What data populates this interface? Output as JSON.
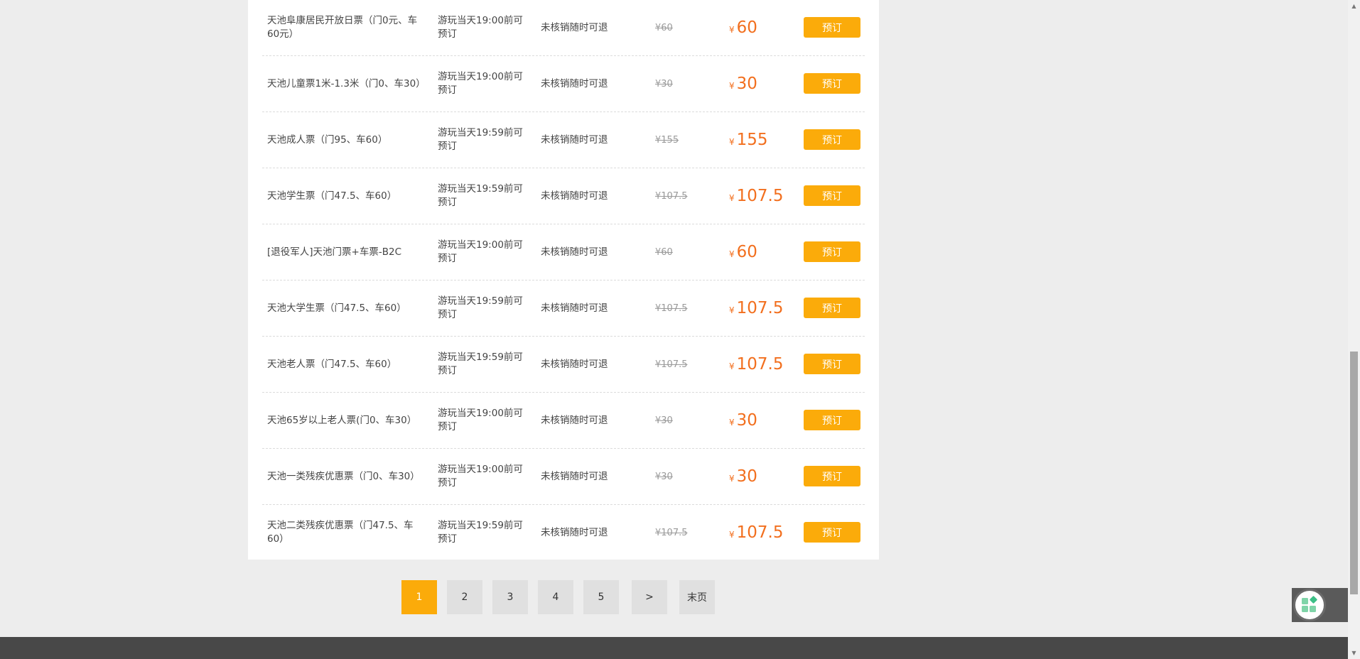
{
  "currency_symbol": "¥",
  "book_label": "预订",
  "tickets": [
    {
      "name": "天池阜康居民开放日票（门0元、车60元）",
      "booking_time": "游玩当天19:00前可预订",
      "refund": "未核销随时可退",
      "original_price": "¥60",
      "price": "60"
    },
    {
      "name": "天池儿童票1米-1.3米（门0、车30）",
      "booking_time": "游玩当天19:00前可预订",
      "refund": "未核销随时可退",
      "original_price": "¥30",
      "price": "30"
    },
    {
      "name": "天池成人票（门95、车60）",
      "booking_time": "游玩当天19:59前可预订",
      "refund": "未核销随时可退",
      "original_price": "¥155",
      "price": "155"
    },
    {
      "name": "天池学生票（门47.5、车60）",
      "booking_time": "游玩当天19:59前可预订",
      "refund": "未核销随时可退",
      "original_price": "¥107.5",
      "price": "107.5"
    },
    {
      "name": "[退役军人]天池门票+车票-B2C",
      "booking_time": "游玩当天19:00前可预订",
      "refund": "未核销随时可退",
      "original_price": "¥60",
      "price": "60"
    },
    {
      "name": "天池大学生票（门47.5、车60）",
      "booking_time": "游玩当天19:59前可预订",
      "refund": "未核销随时可退",
      "original_price": "¥107.5",
      "price": "107.5"
    },
    {
      "name": "天池老人票（门47.5、车60）",
      "booking_time": "游玩当天19:59前可预订",
      "refund": "未核销随时可退",
      "original_price": "¥107.5",
      "price": "107.5"
    },
    {
      "name": "天池65岁以上老人票(门0、车30）",
      "booking_time": "游玩当天19:00前可预订",
      "refund": "未核销随时可退",
      "original_price": "¥30",
      "price": "30"
    },
    {
      "name": "天池一类残疾优惠票（门0、车30）",
      "booking_time": "游玩当天19:00前可预订",
      "refund": "未核销随时可退",
      "original_price": "¥30",
      "price": "30"
    },
    {
      "name": "天池二类残疾优惠票（门47.5、车60）",
      "booking_time": "游玩当天19:59前可预订",
      "refund": "未核销随时可退",
      "original_price": "¥107.5",
      "price": "107.5"
    }
  ],
  "pagination": {
    "pages": [
      "1",
      "2",
      "3",
      "4",
      "5"
    ],
    "current": "1",
    "next_label": ">",
    "last_label": "末页"
  },
  "colors": {
    "accent": "#fbab0a",
    "price": "#f26f1e",
    "footer": "#484848"
  },
  "icons": {
    "float_widget": "apps-grid-icon"
  }
}
